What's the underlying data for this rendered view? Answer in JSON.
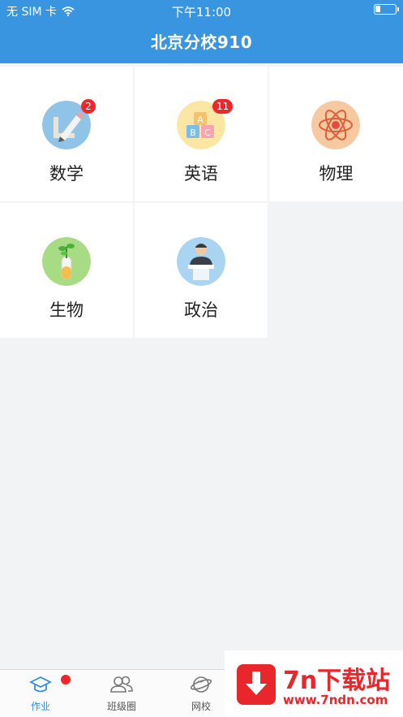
{
  "status_bar": {
    "carrier": "无 SIM 卡",
    "time": "下午11:00",
    "icons": [
      "wifi-icon",
      "battery-icon"
    ]
  },
  "header": {
    "title": "北京分校910"
  },
  "subjects": [
    {
      "label": "数学",
      "icon": "geometry-pencil-icon",
      "badge": "2"
    },
    {
      "label": "英语",
      "icon": "abc-blocks-icon",
      "badge": "11"
    },
    {
      "label": "物理",
      "icon": "atom-icon",
      "badge": ""
    },
    {
      "label": "生物",
      "icon": "test-tube-plant-icon",
      "badge": ""
    },
    {
      "label": "政治",
      "icon": "speaker-podium-icon",
      "badge": ""
    }
  ],
  "tabbar": {
    "items": [
      {
        "label": "作业",
        "icon": "graduation-cap-icon",
        "active": true,
        "dot": true
      },
      {
        "label": "班级圈",
        "icon": "people-icon",
        "active": false,
        "dot": false
      },
      {
        "label": "网校",
        "icon": "globe-icon",
        "active": false,
        "dot": false
      }
    ]
  },
  "watermark": {
    "title": "7n下载站",
    "url": "www.7ndn.com"
  },
  "colors": {
    "header_bg": "#3a95e0",
    "badge": "#f0262b",
    "tab_active": "#2f8fe3",
    "watermark": "#e8262c"
  }
}
